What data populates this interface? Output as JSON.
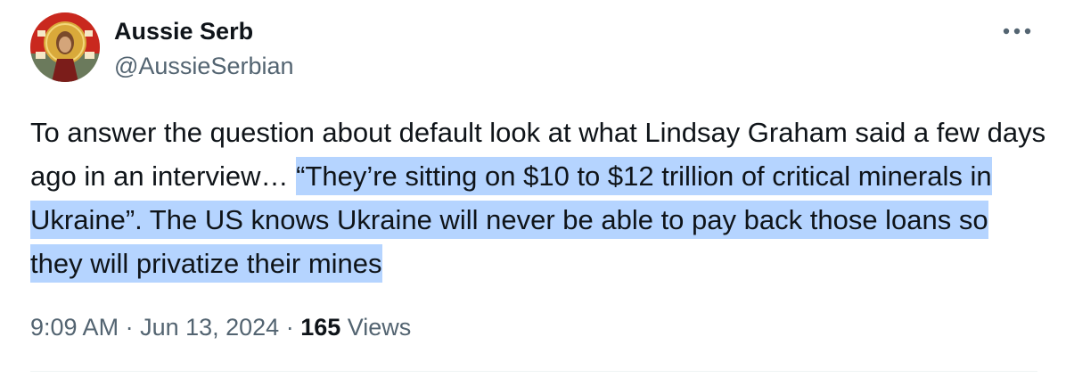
{
  "author": {
    "name": "Aussie Serb",
    "handle": "@AussieSerbian",
    "avatar_icon": "icon-portrait-avatar"
  },
  "more_icon": "more-horizontal-icon",
  "tweet": {
    "text_plain": "To answer the question about default look at what Lindsay Graham said a few days ago in an interview…  ",
    "text_highlighted": "“They’re sitting on $10 to $12 trillion of critical minerals in Ukraine”. The US knows Ukraine will never be able to pay back those loans so they will privatize their mines",
    "highlight_color": "#b5d4ff"
  },
  "meta": {
    "time": "9:09 AM",
    "separator1": " · ",
    "date": "Jun 13, 2024",
    "separator2": " · ",
    "views_count": "165",
    "views_label": " Views"
  },
  "colors": {
    "text_primary": "#0f1419",
    "text_secondary": "#536471",
    "divider": "#eff3f4"
  }
}
